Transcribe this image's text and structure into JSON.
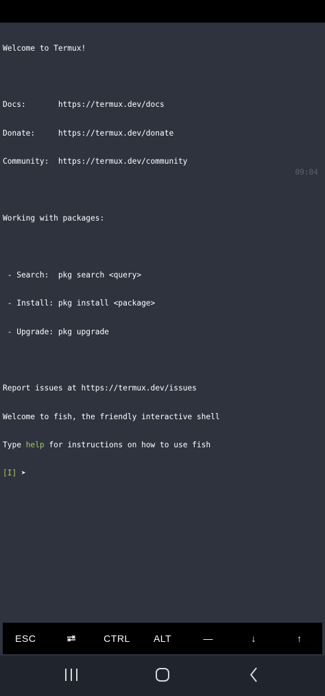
{
  "terminal": {
    "lines": [
      "Welcome to Termux!",
      "",
      "Docs:       https://termux.dev/docs",
      "Donate:     https://termux.dev/donate",
      "Community:  https://termux.dev/community",
      "",
      "Working with packages:",
      "",
      " - Search:  pkg search <query>",
      " - Install: pkg install <package>",
      " - Upgrade: pkg upgrade",
      "",
      "Report issues at https://termux.dev/issues",
      "Welcome to fish, the friendly interactive shell"
    ],
    "help_line": {
      "before": "Type ",
      "command": "help",
      "after": " for instructions on how to use fish"
    },
    "prompt": {
      "mode": "[I]",
      "arrow": "➤"
    },
    "clock": "09:04"
  },
  "extra_keys": [
    {
      "label": "ESC",
      "icon": ""
    },
    {
      "label": "",
      "icon": "tab-icon"
    },
    {
      "label": "CTRL",
      "icon": ""
    },
    {
      "label": "ALT",
      "icon": ""
    },
    {
      "label": "—",
      "icon": ""
    },
    {
      "label": "↓",
      "icon": ""
    },
    {
      "label": "↑",
      "icon": ""
    }
  ],
  "nav_bar": {
    "recents_icon": "recents-icon",
    "home_icon": "home-icon",
    "back_icon": "back-icon"
  },
  "colors": {
    "terminal_bg": "#2e333e",
    "text": "#ffffff",
    "accent_green": "#a6c95f",
    "clock": "#596172",
    "status_bar": "#000000",
    "nav_bar": "#20242c"
  }
}
